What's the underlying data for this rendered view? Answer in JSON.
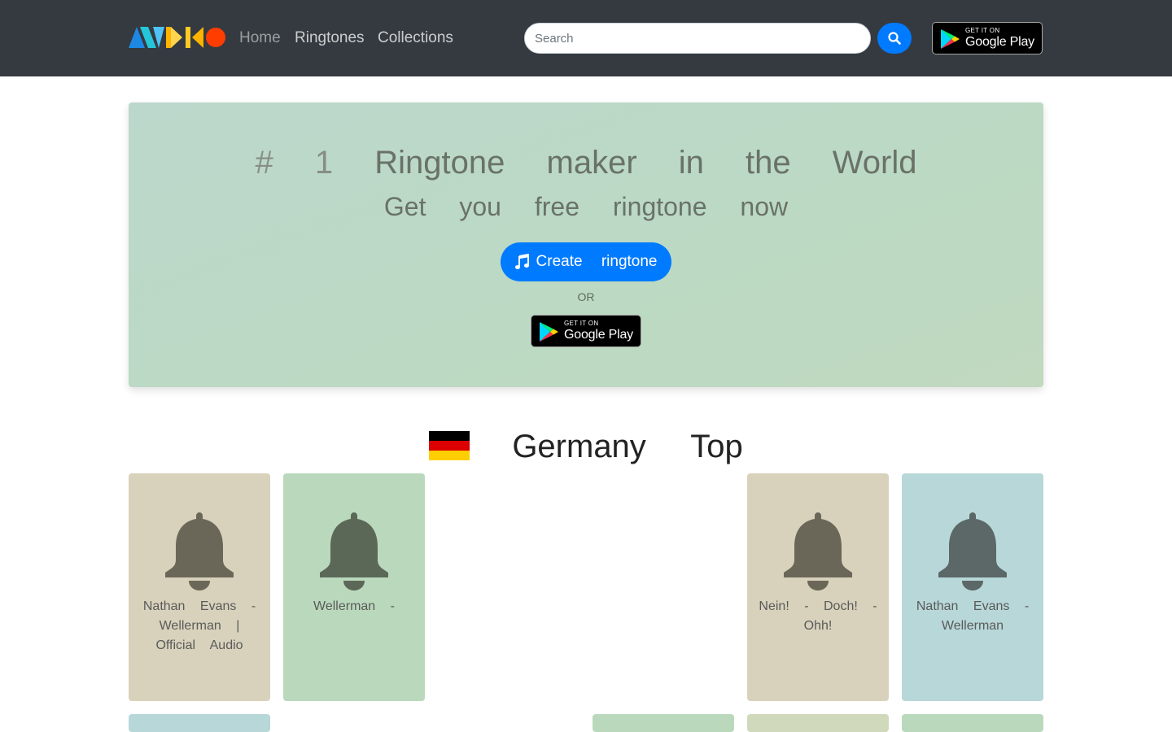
{
  "nav": {
    "home": "Home",
    "ringtones": "Ringtones",
    "collections": "Collections",
    "search_placeholder": "Search",
    "gp_small": "GET IT ON",
    "gp_big": "Google Play"
  },
  "hero": {
    "title_num": "# 1",
    "title_rest": "Ringtone maker in the World",
    "subtitle": "Get you free ringtone now",
    "create_label": "Create ringtone",
    "or": "OR",
    "gp_small": "GET IT ON",
    "gp_big": "Google Play"
  },
  "section": {
    "title": "Germany Top",
    "flag_colors": [
      "#000000",
      "#dd0000",
      "#ffce00"
    ]
  },
  "cards": [
    {
      "title": "Nathan Evans - Wellerman | Official Audio",
      "bg": "#d8d2bc",
      "bell": "#6b6758"
    },
    {
      "title": "Wellerman -",
      "bg": "#bad9bc",
      "bell": "#5b6858"
    },
    {
      "title": "Nein! - Doch! - Ohh!",
      "bg": "#d8d2bc",
      "bell": "#6b6758"
    },
    {
      "title": "Nathan Evans - Wellerman",
      "bg": "#b8d7d8",
      "bell": "#5b6867"
    }
  ],
  "row2_colors": [
    "#b8d7d8",
    "#bad9bc",
    "#d1d9bc",
    "#bad9bc"
  ]
}
